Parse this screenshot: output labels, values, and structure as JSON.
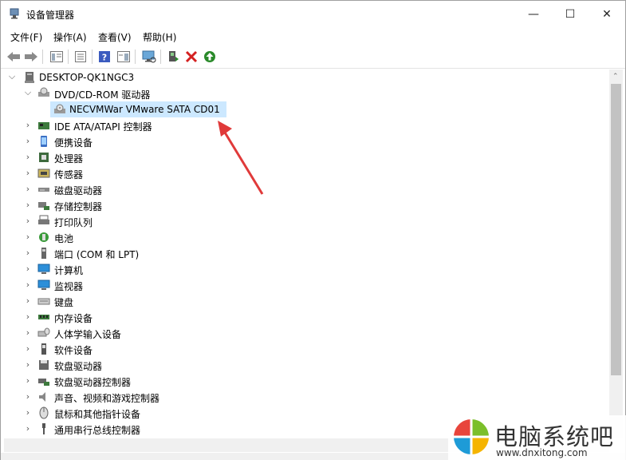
{
  "window": {
    "title": "设备管理器",
    "minimize": "—",
    "maximize": "☐",
    "close": "✕"
  },
  "menu": [
    "文件(F)",
    "操作(A)",
    "查看(V)",
    "帮助(H)"
  ],
  "tree": {
    "root": "DESKTOP-QK1NGC3",
    "categories": [
      {
        "label": "DVD/CD-ROM 驱动器",
        "icon": "dvd-drive-icon",
        "expanded": true,
        "children": [
          {
            "label": "NECVMWar VMware SATA CD01",
            "selected": true
          }
        ]
      },
      {
        "label": "IDE ATA/ATAPI 控制器",
        "icon": "ide-controller-icon"
      },
      {
        "label": "便携设备",
        "icon": "portable-device-icon"
      },
      {
        "label": "处理器",
        "icon": "processor-icon"
      },
      {
        "label": "传感器",
        "icon": "sensor-icon"
      },
      {
        "label": "磁盘驱动器",
        "icon": "disk-drive-icon"
      },
      {
        "label": "存储控制器",
        "icon": "storage-controller-icon"
      },
      {
        "label": "打印队列",
        "icon": "printer-icon"
      },
      {
        "label": "电池",
        "icon": "battery-icon"
      },
      {
        "label": "端口 (COM 和 LPT)",
        "icon": "port-icon"
      },
      {
        "label": "计算机",
        "icon": "computer-icon"
      },
      {
        "label": "监视器",
        "icon": "monitor-icon"
      },
      {
        "label": "键盘",
        "icon": "keyboard-icon"
      },
      {
        "label": "内存设备",
        "icon": "memory-icon"
      },
      {
        "label": "人体学输入设备",
        "icon": "hid-icon"
      },
      {
        "label": "软件设备",
        "icon": "software-device-icon"
      },
      {
        "label": "软盘驱动器",
        "icon": "floppy-drive-icon"
      },
      {
        "label": "软盘驱动器控制器",
        "icon": "floppy-controller-icon"
      },
      {
        "label": "声音、视频和游戏控制器",
        "icon": "sound-icon"
      },
      {
        "label": "鼠标和其他指针设备",
        "icon": "mouse-icon"
      },
      {
        "label": "通用串行总线控制器",
        "icon": "usb-icon"
      }
    ]
  },
  "watermark": {
    "title": "电脑系统吧",
    "url": "www.dnxitong.com"
  },
  "colors": {
    "selection": "#cce8ff",
    "arrow": "#e03a3a",
    "delete": "#d42020",
    "update": "#2a8a2a"
  }
}
